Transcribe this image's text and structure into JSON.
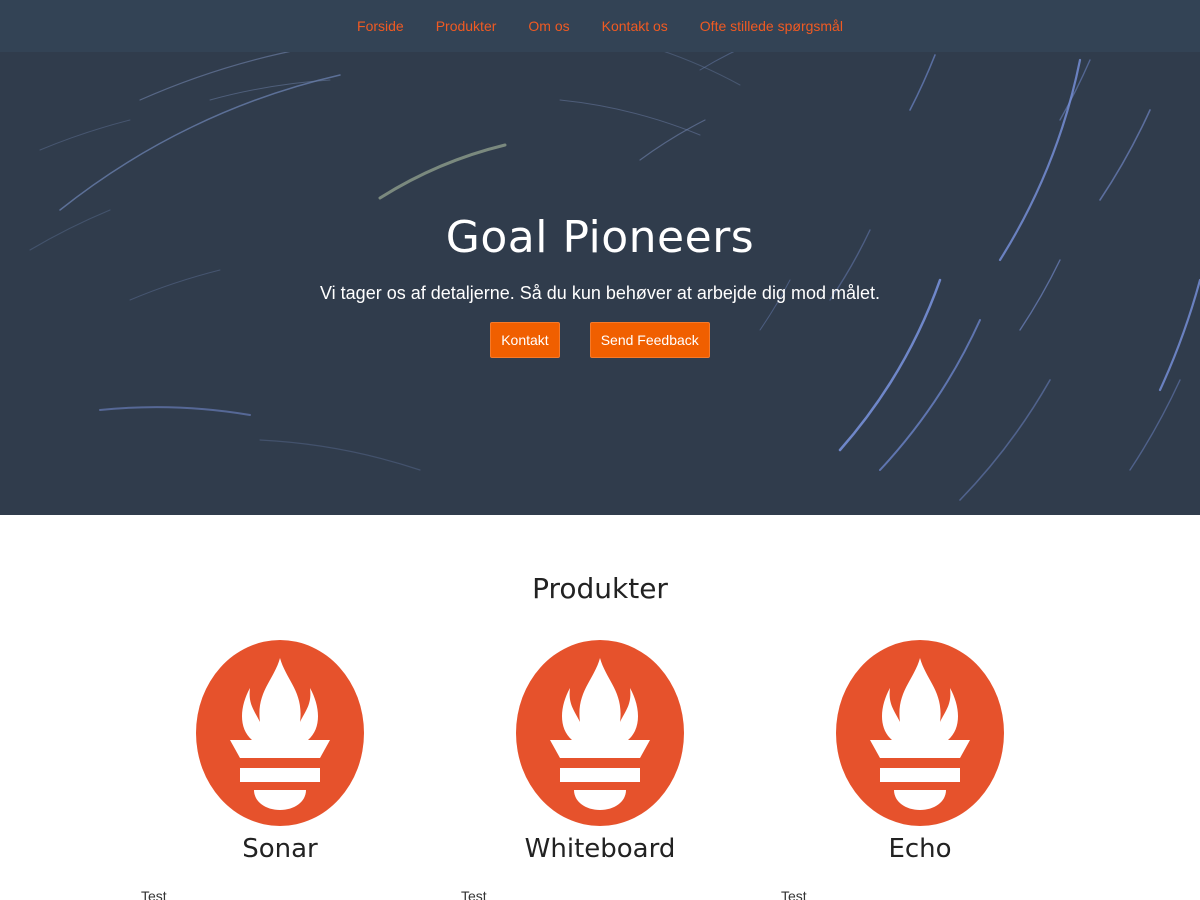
{
  "nav": {
    "items": [
      "Forside",
      "Produkter",
      "Om os",
      "Kontakt os",
      "Ofte stillede spørgsmål"
    ]
  },
  "hero": {
    "title": "Goal Pioneers",
    "subtitle": "Vi tager os af detaljerne. Så du kun behøver at arbejde dig mod målet.",
    "buttons": {
      "contact": "Kontakt",
      "feedback": "Send Feedback"
    }
  },
  "products": {
    "heading": "Produkter",
    "items": [
      {
        "name": "Sonar",
        "desc": "Test",
        "icon": "flame-torch-icon"
      },
      {
        "name": "Whiteboard",
        "desc": "Test",
        "icon": "flame-torch-icon"
      },
      {
        "name": "Echo",
        "desc": "Test",
        "icon": "flame-torch-icon"
      }
    ]
  },
  "colors": {
    "accent": "#f05a22",
    "navbar": "#334355",
    "hero_bg": "#303c4c",
    "button": "#f05f00",
    "logo": "#e6522c"
  }
}
